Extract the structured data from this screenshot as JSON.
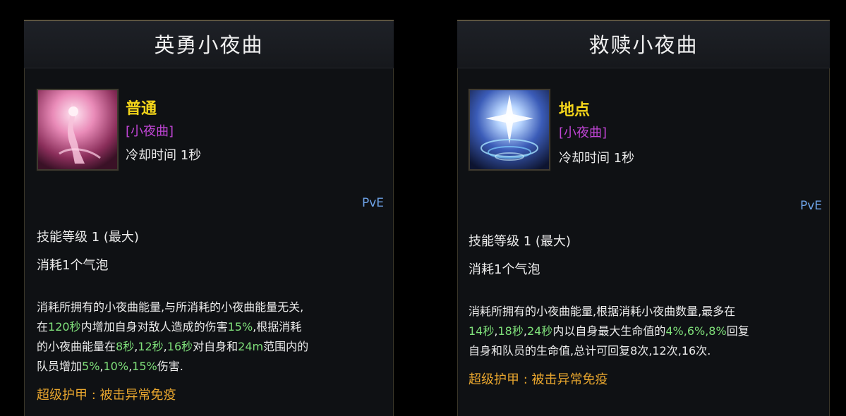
{
  "panels": [
    {
      "title": "英勇小夜曲",
      "icon": "dancer-pink-skill-icon",
      "category": "普通",
      "tag": "[小夜曲]",
      "cooldown": "冷却时间 1秒",
      "mode": "PvE",
      "level": "技能等级 1 (最大)",
      "cost": "消耗1个气泡",
      "desc": {
        "l1": "消耗所拥有的小夜曲能量,与所消耗的小夜曲能量无关,",
        "l2a": "在",
        "l2b": "120秒",
        "l2c": "内增加自身对敌人造成的伤害",
        "l2d": "15%",
        "l2e": ",根据消耗",
        "l3a": "的小夜曲能量在",
        "l3b": "8秒",
        "l3c": ",",
        "l3d": "12秒",
        "l3e": ",",
        "l3f": "16秒",
        "l3g": "对自身和",
        "l3h": "24m",
        "l3i": "范围内的",
        "l4a": "队员增加",
        "l4b": "5%",
        "l4c": ",",
        "l4d": "10%",
        "l4e": ",",
        "l4f": "15%",
        "l4g": "伤害."
      },
      "armor": "超级护甲 : 被击异常免疫"
    },
    {
      "title": "救赎小夜曲",
      "icon": "blue-star-burst-skill-icon",
      "category": "地点",
      "tag": "[小夜曲]",
      "cooldown": "冷却时间 1秒",
      "mode": "PvE",
      "level": "技能等级 1 (最大)",
      "cost": "消耗1个气泡",
      "desc": {
        "l1": "消耗所拥有的小夜曲能量,根据消耗小夜曲数量,最多在",
        "l2a": "14秒",
        "l2b": ",",
        "l2c": "18秒",
        "l2d": ",",
        "l2e": "24秒",
        "l2f": "内以自身最大生命值的",
        "l2g": "4%",
        "l2h": ",",
        "l2i": "6%",
        "l2j": ",",
        "l2k": "8%",
        "l2l": "回复",
        "l3a": "自身和队员的生命值,总计可回复",
        "l3b": "8次",
        "l3c": ",",
        "l3d": "12次",
        "l3e": ",",
        "l3f": "16次",
        "l3g": "."
      },
      "armor": "超级护甲 : 被击异常免疫"
    }
  ],
  "colors": {
    "category": "#f4d51a",
    "tag": "#c145d6",
    "highlight": "#7fe07a",
    "armor": "#e7a52e",
    "pve": "#6ea3e8"
  }
}
